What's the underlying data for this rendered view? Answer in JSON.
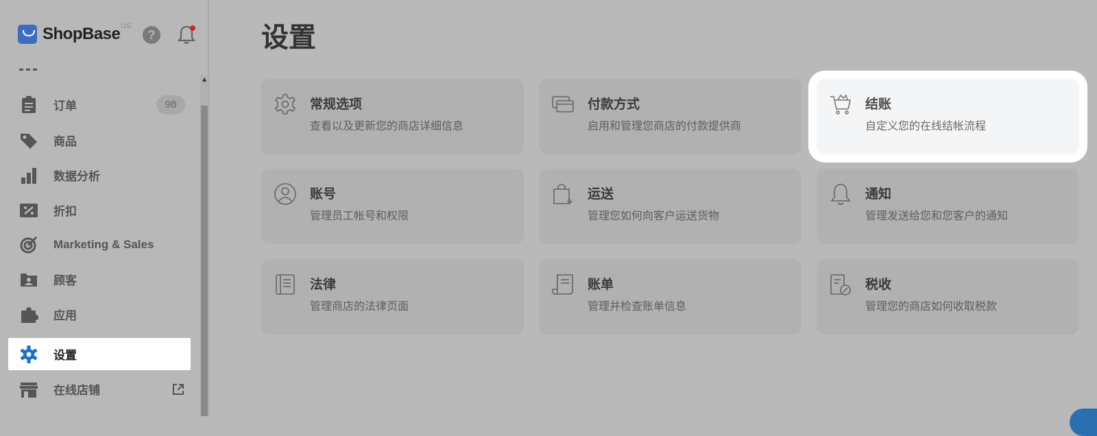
{
  "sidebar": {
    "brand": "ShopBase",
    "region": "US",
    "help_glyph": "?",
    "items": [
      {
        "label": "订单",
        "icon": "clipboard-icon",
        "badge": "98"
      },
      {
        "label": "商品",
        "icon": "tag-icon"
      },
      {
        "label": "数据分析",
        "icon": "bar-chart-icon"
      },
      {
        "label": "折扣",
        "icon": "discount-icon"
      },
      {
        "label": "Marketing & Sales",
        "icon": "target-icon"
      },
      {
        "label": "顾客",
        "icon": "customer-icon"
      },
      {
        "label": "应用",
        "icon": "puzzle-icon"
      },
      {
        "label": "设置",
        "icon": "gear-icon",
        "active": true
      },
      {
        "label": "在线店铺",
        "icon": "store-icon",
        "external": true
      }
    ]
  },
  "main": {
    "title": "设置",
    "cards": [
      {
        "title": "常规选项",
        "desc": "查看以及更新您的商店详细信息",
        "icon": "gear-icon"
      },
      {
        "title": "付款方式",
        "desc": "启用和管理您商店的付款提供商",
        "icon": "payment-icon"
      },
      {
        "title": "结账",
        "desc": "自定义您的在线结帐流程",
        "icon": "cart-icon",
        "highlight": true
      },
      {
        "title": "账号",
        "desc": "管理员工帐号和权限",
        "icon": "user-circle-icon"
      },
      {
        "title": "运送",
        "desc": "管理您如何向客户运送货物",
        "icon": "shopping-bag-icon"
      },
      {
        "title": "通知",
        "desc": "管理发送给您和您客户的通知",
        "icon": "bell-icon"
      },
      {
        "title": "法律",
        "desc": "管理商店的法律页面",
        "icon": "document-icon"
      },
      {
        "title": "账单",
        "desc": "管理并检查账单信息",
        "icon": "receipt-icon"
      },
      {
        "title": "税收",
        "desc": "管理您的商店如何收取税款",
        "icon": "tax-document-icon"
      }
    ]
  },
  "colors": {
    "overlay": "#b9b9b9",
    "active_accent": "#1a73c8",
    "highlight_card": "#f4f5f7",
    "notification_dot": "#d4231f"
  }
}
